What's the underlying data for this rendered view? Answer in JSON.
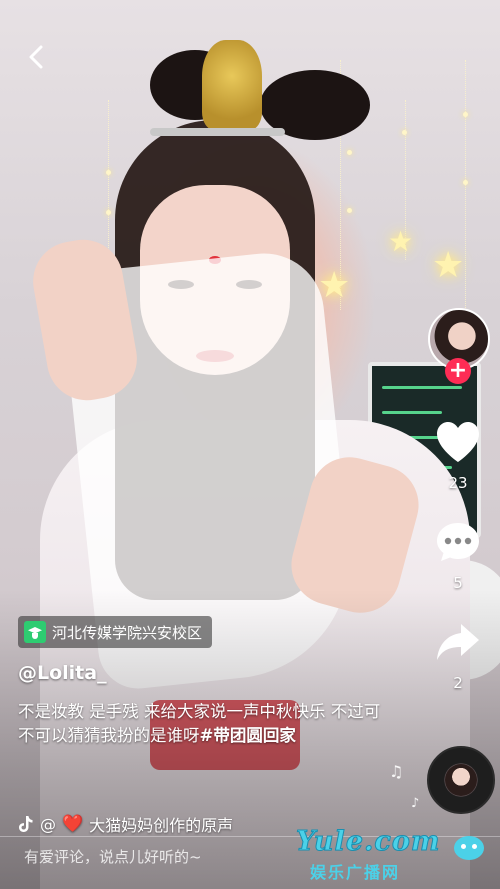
{
  "header": {
    "back_icon": "chevron-left-icon"
  },
  "creator": {
    "avatar_icon": "creator-avatar",
    "follow_label": "+"
  },
  "actions": {
    "like": {
      "icon": "heart-icon",
      "count": "23"
    },
    "comment": {
      "icon": "comment-bubble-icon",
      "count": "5"
    },
    "share": {
      "icon": "share-arrow-icon",
      "count": "2"
    }
  },
  "location": {
    "icon": "location-school-icon",
    "label": "河北传媒学院兴安校区"
  },
  "post": {
    "username": "@Lolita_",
    "caption_text": "不是妆教 是手残 来给大家说一声中秋快乐 不过可不可以猜猜我扮的是谁呀",
    "caption_hashtag": "#带团圆回家"
  },
  "sound": {
    "icon": "tiktok-note-icon",
    "prefix": "@",
    "heart": "❤️",
    "text": "大猫妈妈创作的原声"
  },
  "comment_bar": {
    "placeholder": "有爱评论，说点儿好听的~"
  },
  "watermark": {
    "main": "Yule.com",
    "sub": "娱乐广播网"
  },
  "colors": {
    "follow_red": "#fe2c55",
    "location_green": "#2ecc71",
    "watermark_cyan": "#4bd1e8"
  }
}
